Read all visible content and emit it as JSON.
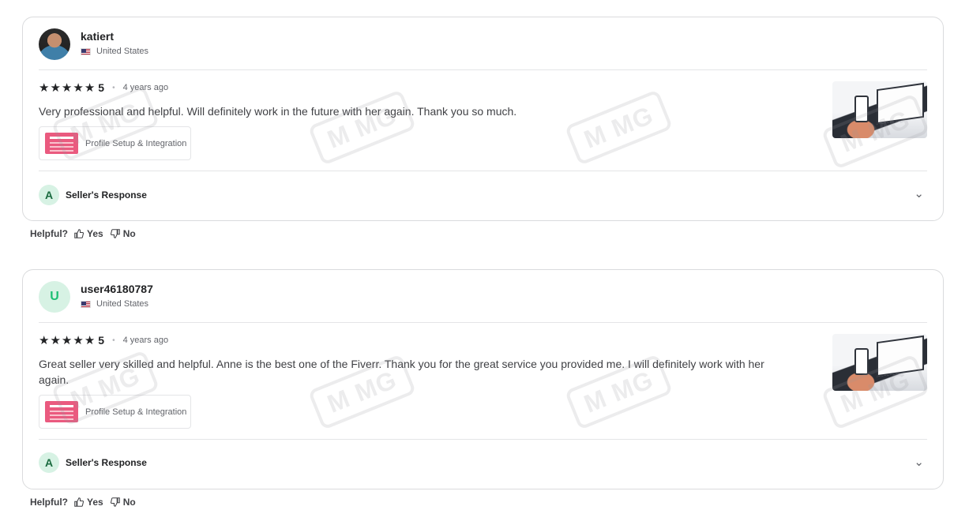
{
  "reviews": [
    {
      "username": "katiert",
      "country": "United States",
      "rating": "5",
      "time_ago": "4 years ago",
      "text": "Very professional and helpful. Will definitely work in the future with her again. Thank you so much.",
      "gig_title": "Profile Setup & Integration",
      "avatar_type": "photo",
      "response_initial": "A",
      "response_label": "Seller's Response"
    },
    {
      "username": "user46180787",
      "country": "United States",
      "avatar_letter": "U",
      "rating": "5",
      "time_ago": "4 years ago",
      "text": "Great seller very skilled and helpful. Anne is the best one of the Fiverr. Thank you for the great service you provided me. I will definitely work with her again.",
      "gig_title": "Profile Setup & Integration",
      "avatar_type": "letter",
      "response_initial": "A",
      "response_label": "Seller's Response"
    }
  ],
  "helpful": {
    "label": "Helpful?",
    "yes": "Yes",
    "no": "No"
  },
  "icons": {
    "star": "star-icon",
    "thumbs_up": "thumbs-up-icon",
    "thumbs_down": "thumbs-down-icon",
    "chevron": "chevron-down-icon"
  },
  "colors": {
    "avatar_bg": "#d7f2e4",
    "avatar_fg": "#1dbf73",
    "gig_thumb": "#ea5a7f"
  }
}
